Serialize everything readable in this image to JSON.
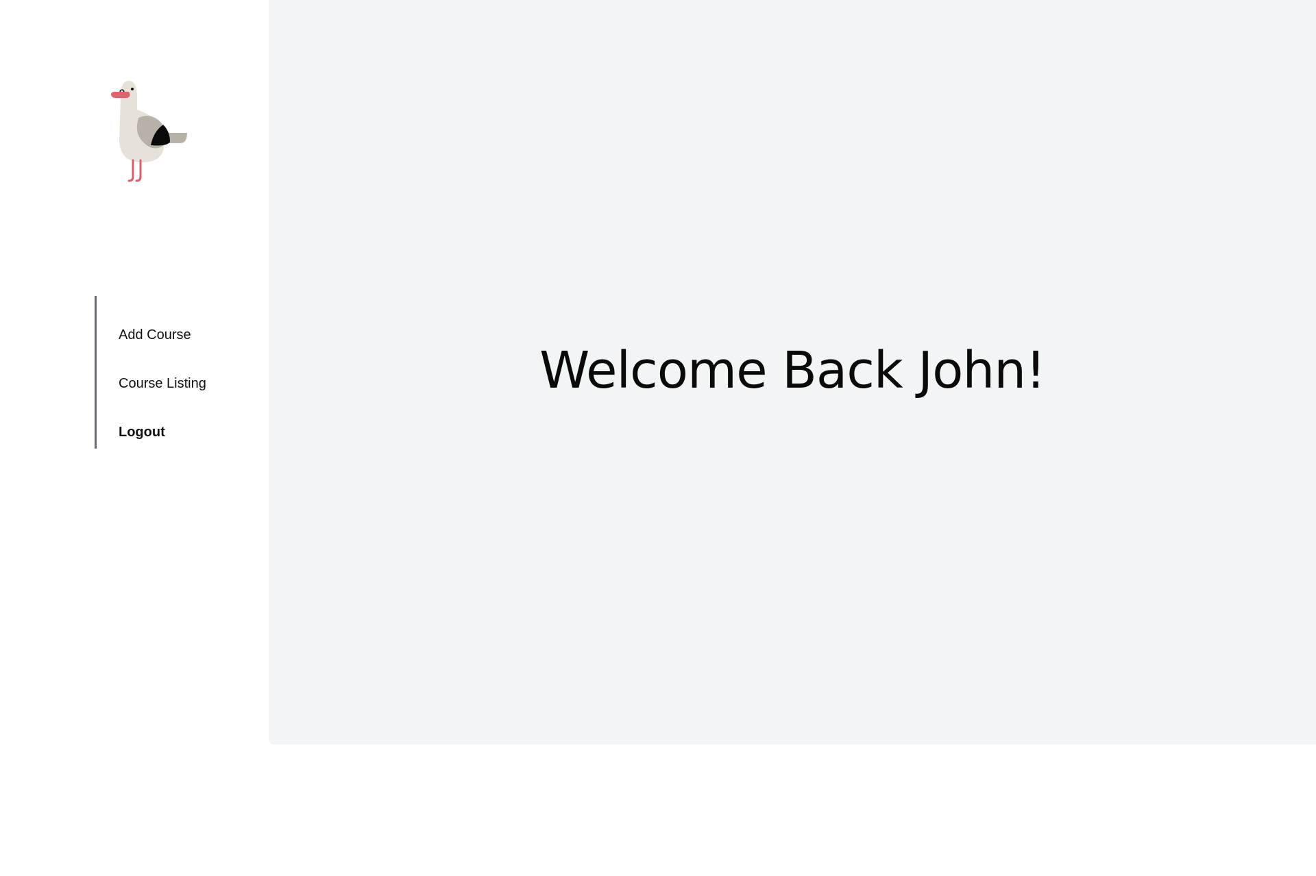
{
  "nav": {
    "items": [
      {
        "label": "Add Course"
      },
      {
        "label": "Course Listing"
      },
      {
        "label": "Logout"
      }
    ]
  },
  "main": {
    "welcome": "Welcome Back John!"
  },
  "logo": {
    "icon": "seagull-icon",
    "colors": {
      "body": "#e6e2da",
      "wing": "#b7b1a8",
      "wingtip": "#0a0a0a",
      "beak": "#e0616d",
      "legs": "#d95f6d"
    }
  }
}
